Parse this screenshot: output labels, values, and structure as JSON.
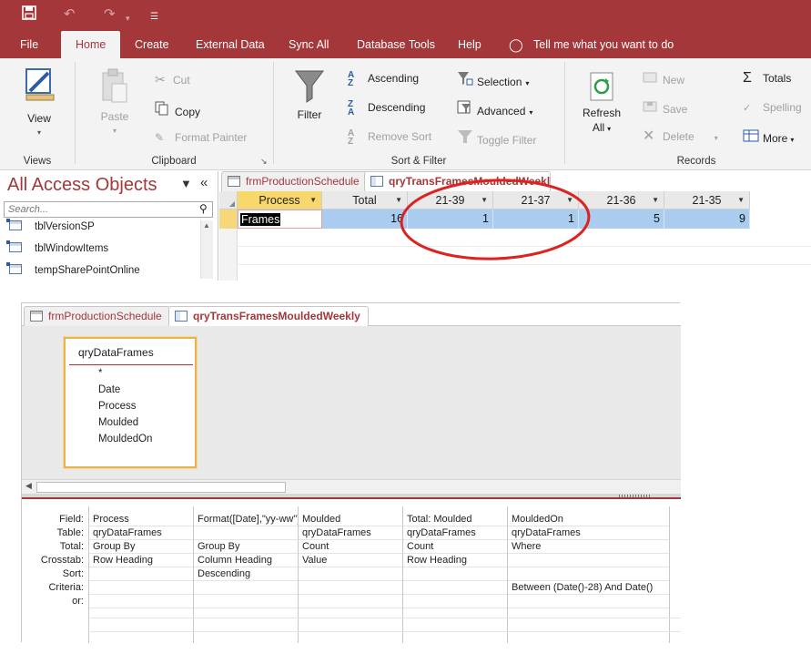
{
  "quick_access": {
    "save_icon": "save-icon",
    "undo_icon": "undo-icon",
    "redo_icon": "redo-icon",
    "customize_icon": "customize-toolbar-icon"
  },
  "menu": {
    "tabs": [
      "File",
      "Home",
      "Create",
      "External Data",
      "Sync All",
      "Database Tools",
      "Help"
    ],
    "active": "Home",
    "tell_me": "Tell me what you want to do"
  },
  "ribbon": {
    "views": {
      "view_label": "View",
      "group": "Views"
    },
    "clipboard": {
      "paste": "Paste",
      "cut": "Cut",
      "copy": "Copy",
      "format_painter": "Format Painter",
      "group": "Clipboard"
    },
    "sort_filter": {
      "filter": "Filter",
      "ascending": "Ascending",
      "descending": "Descending",
      "remove_sort": "Remove Sort",
      "selection": "Selection",
      "advanced": "Advanced",
      "toggle_filter": "Toggle Filter",
      "group": "Sort & Filter"
    },
    "records": {
      "refresh": "Refresh",
      "refresh_all": "All",
      "new": "New",
      "save": "Save",
      "delete": "Delete",
      "totals": "Totals",
      "spelling": "Spelling",
      "more": "More",
      "group": "Records"
    },
    "accent": "#a4373a"
  },
  "nav": {
    "title": "All Access Objects",
    "search_placeholder": "Search...",
    "items": [
      "tblVersionSP",
      "tblWindowItems",
      "tempSharePointOnline"
    ]
  },
  "datasheet": {
    "tabs": [
      "frmProductionSchedule",
      "qryTransFramesMouldedWeekly"
    ],
    "active_tab": 1,
    "columns": [
      "Process",
      "Total",
      "21-39",
      "21-37",
      "21-36",
      "21-35"
    ],
    "row": [
      "Frames",
      "16",
      "1",
      "1",
      "5",
      "9"
    ]
  },
  "design": {
    "tabs": [
      "frmProductionSchedule",
      "qryTransFramesMouldedWeekly"
    ],
    "active_tab": 1,
    "field_list": {
      "title": "qryDataFrames",
      "fields": [
        "*",
        "Date",
        "Process",
        "Moulded",
        "MouldedOn"
      ]
    },
    "row_labels": [
      "Field:",
      "Table:",
      "Total:",
      "Crosstab:",
      "Sort:",
      "Criteria:",
      "or:"
    ],
    "columns": [
      {
        "field": "Process",
        "table": "qryDataFrames",
        "total": "Group By",
        "crosstab": "Row Heading",
        "sort": "",
        "criteria": "",
        "or": ""
      },
      {
        "field": "Format([Date],\"yy-ww\")",
        "table": "",
        "total": "Group By",
        "crosstab": "Column Heading",
        "sort": "Descending",
        "criteria": "",
        "or": ""
      },
      {
        "field": "Moulded",
        "table": "qryDataFrames",
        "total": "Count",
        "crosstab": "Value",
        "sort": "",
        "criteria": "",
        "or": ""
      },
      {
        "field": "Total: Moulded",
        "table": "qryDataFrames",
        "total": "Count",
        "crosstab": "Row Heading",
        "sort": "",
        "criteria": "",
        "or": ""
      },
      {
        "field": "MouldedOn",
        "table": "qryDataFrames",
        "total": "Where",
        "crosstab": "",
        "sort": "",
        "criteria": "Between (Date()-28) And Date()",
        "or": ""
      }
    ]
  }
}
